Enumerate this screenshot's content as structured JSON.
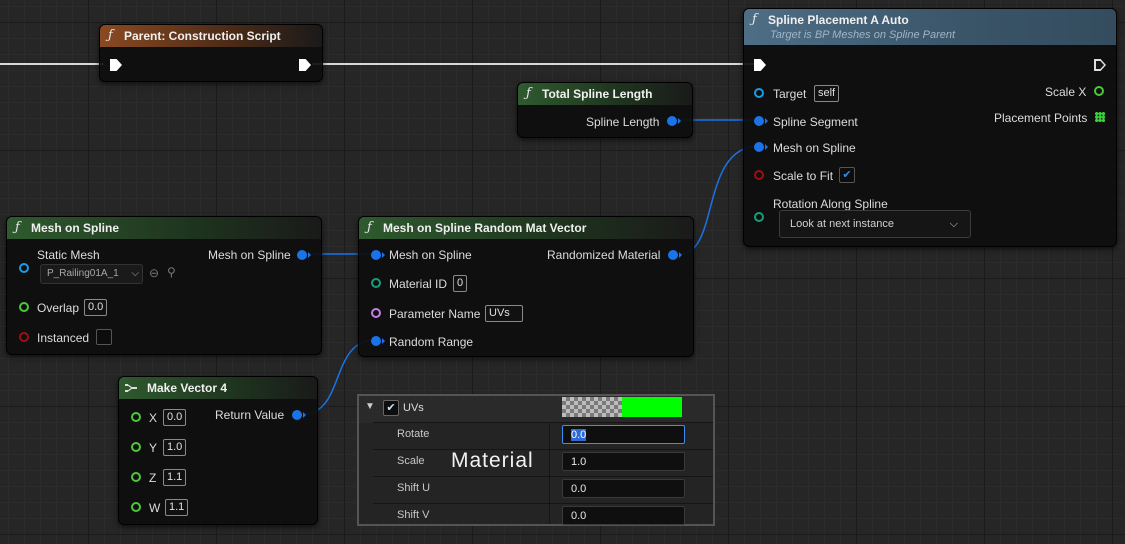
{
  "nodes": {
    "parent": {
      "title": "Parent: Construction Script"
    },
    "total_length": {
      "title": "Total Spline Length",
      "out_label": "Spline Length"
    },
    "spline_placement": {
      "title": "Spline Placement A Auto",
      "subtitle": "Target is BP Meshes on Spline Parent",
      "target_label": "Target",
      "target_value": "self",
      "spline_segment_label": "Spline Segment",
      "mesh_on_spline_label": "Mesh on Spline",
      "scale_to_fit_label": "Scale to Fit",
      "rotation_label": "Rotation Along Spline",
      "rotation_option": "Look at next instance",
      "scale_x_label": "Scale X",
      "placement_points_label": "Placement Points"
    },
    "mesh_on_spline": {
      "title": "Mesh on Spline",
      "static_mesh_label": "Static Mesh",
      "static_mesh_value": "P_Railing01A_1",
      "out_label": "Mesh on Spline",
      "overlap_label": "Overlap",
      "overlap_value": "0.0",
      "instanced_label": "Instanced"
    },
    "random_mat": {
      "title": "Mesh on Spline Random Mat Vector",
      "mesh_label": "Mesh on Spline",
      "material_id_label": "Material ID",
      "material_id_value": "0",
      "param_name_label": "Parameter Name",
      "param_name_value": "UVs",
      "random_range_label": "Random Range",
      "out_label": "Randomized Material"
    },
    "make_vector": {
      "title": "Make Vector 4",
      "x_label": "X",
      "x_value": "0.0",
      "y_label": "Y",
      "y_value": "1.0",
      "z_label": "Z",
      "z_value": "1.1",
      "w_label": "W",
      "w_value": "1.1",
      "out_label": "Return Value"
    }
  },
  "panel": {
    "header_label": "UVs",
    "overlay_text": "Material",
    "swatch_color": "#00ff00",
    "rows": [
      {
        "label": "Rotate",
        "value": "0.0"
      },
      {
        "label": "Scale",
        "value": "1.0"
      },
      {
        "label": "Shift U",
        "value": "0.0"
      },
      {
        "label": "Shift V",
        "value": "0.0"
      }
    ]
  },
  "colors": {
    "exec": "#ffffff",
    "object_pin": "#1a73e8",
    "float_pin": "#4fc63a",
    "bool_pin": "#a00f0f",
    "name_pin": "#c37ee6"
  }
}
